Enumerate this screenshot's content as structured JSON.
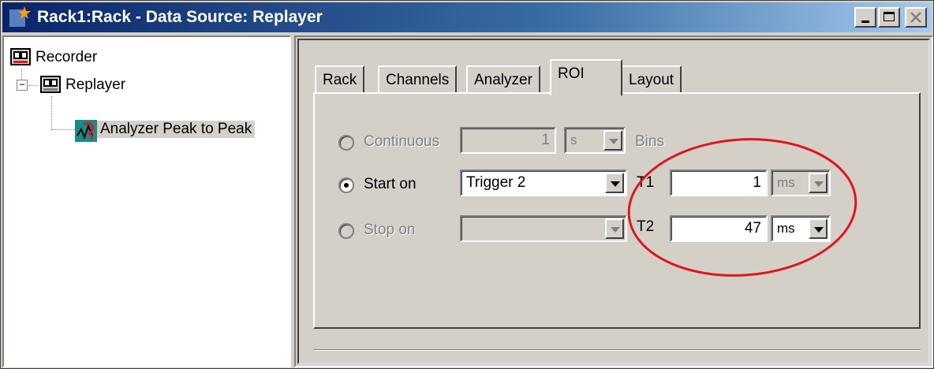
{
  "window": {
    "title": "Rack1:Rack - Data Source: Replayer",
    "minimize_icon": "minimize-icon",
    "maximize_icon": "maximize-icon",
    "close_icon": "close-icon"
  },
  "tree": {
    "items": [
      {
        "label": "Recorder",
        "icon": "recorder-icon"
      },
      {
        "label": "Replayer",
        "icon": "replayer-icon",
        "expander": "⊟"
      },
      {
        "label": "Analyzer Peak to Peak",
        "icon": "analyzer-icon",
        "selected": true
      }
    ],
    "expander_symbol": "−"
  },
  "tabs": [
    {
      "label": "Rack"
    },
    {
      "label": "Channels"
    },
    {
      "label": "Analyzer"
    },
    {
      "label": "ROI",
      "active": true
    },
    {
      "label": "Layout"
    }
  ],
  "roi": {
    "continuous": {
      "label": "Continuous",
      "value": "1",
      "unit": "s",
      "suffix": "Bins",
      "enabled": false
    },
    "start_on": {
      "label": "Start on",
      "value": "Trigger 2",
      "selected": true
    },
    "stop_on": {
      "label": "Stop on",
      "value": "",
      "enabled": false
    },
    "t1": {
      "label": "T1",
      "value": "1",
      "unit": "ms",
      "unit_enabled": false
    },
    "t2": {
      "label": "T2",
      "value": "47",
      "unit": "ms",
      "unit_enabled": true
    }
  },
  "annotation_color": "#e0161c",
  "accent_color": "#0a246a"
}
